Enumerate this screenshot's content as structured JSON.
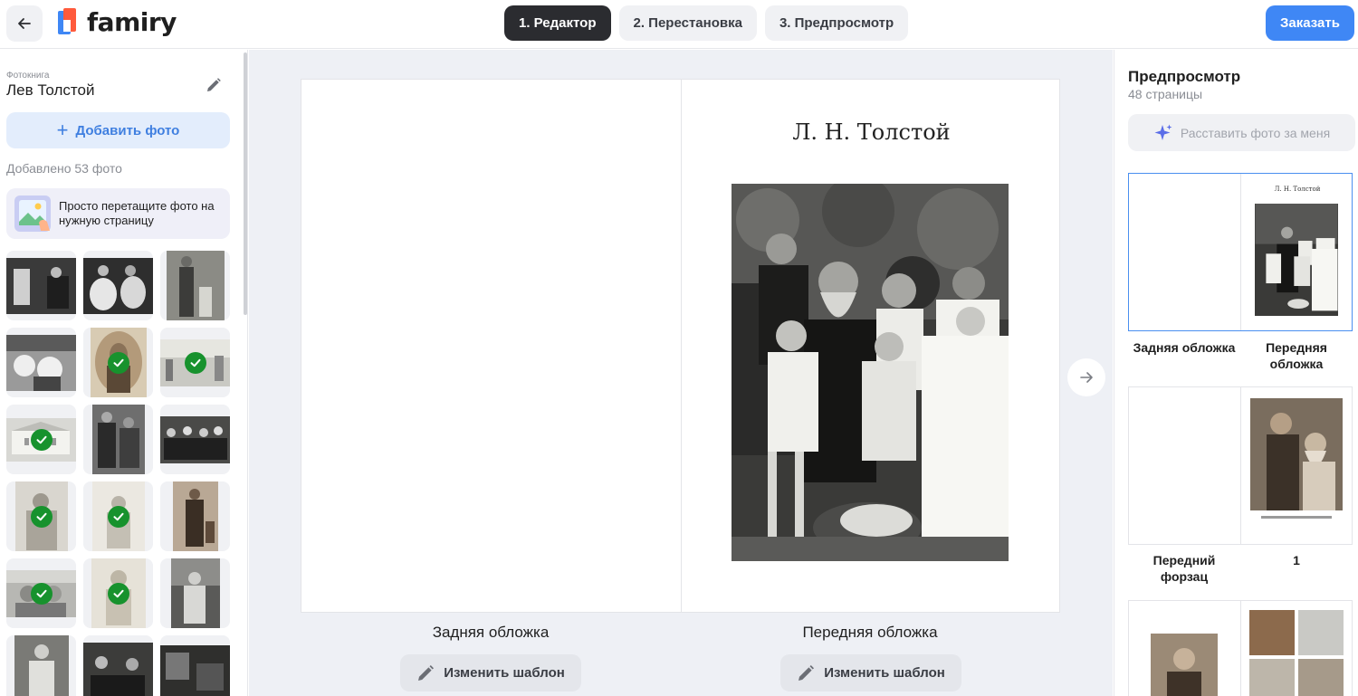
{
  "header": {
    "logo_text": "famiry",
    "steps": [
      {
        "label": "1. Редактор",
        "active": true
      },
      {
        "label": "2. Перестановка",
        "active": false
      },
      {
        "label": "3. Предпросмотр",
        "active": false
      }
    ],
    "order_label": "Заказать"
  },
  "sidebar": {
    "book_kicker": "Фотокнига",
    "book_title": "Лев Толстой",
    "add_photo_label": "Добавить фото",
    "added_count": "Добавлено 53 фото",
    "hint": "Просто перетащите фото на нужную страницу",
    "thumbnails": [
      {
        "checked": false
      },
      {
        "checked": false
      },
      {
        "checked": false
      },
      {
        "checked": false
      },
      {
        "checked": true
      },
      {
        "checked": true
      },
      {
        "checked": true
      },
      {
        "checked": false
      },
      {
        "checked": false
      },
      {
        "checked": true
      },
      {
        "checked": true
      },
      {
        "checked": false
      },
      {
        "checked": true
      },
      {
        "checked": true
      },
      {
        "checked": false
      },
      {
        "checked": false
      },
      {
        "checked": false
      },
      {
        "checked": false
      }
    ]
  },
  "editor": {
    "cover_title": "Л. Н. Толстой",
    "left_page_label": "Задняя обложка",
    "right_page_label": "Передняя обложка",
    "change_template_label": "Изменить шаблон"
  },
  "preview": {
    "title": "Предпросмотр",
    "pages_count": "48 страницы",
    "auto_arrange_label": "Расставить фото за меня",
    "spreads": [
      {
        "left_label": "Задняя обложка",
        "right_label": "Передняя обложка",
        "mini_title": "Л. Н. Толстой"
      },
      {
        "left_label": "Передний форзац",
        "right_label": "1"
      }
    ]
  },
  "colors": {
    "accent": "#3f87f5",
    "active_step": "#2b2c30",
    "check_green": "#17922d",
    "canvas_bg": "#eef0f5"
  }
}
